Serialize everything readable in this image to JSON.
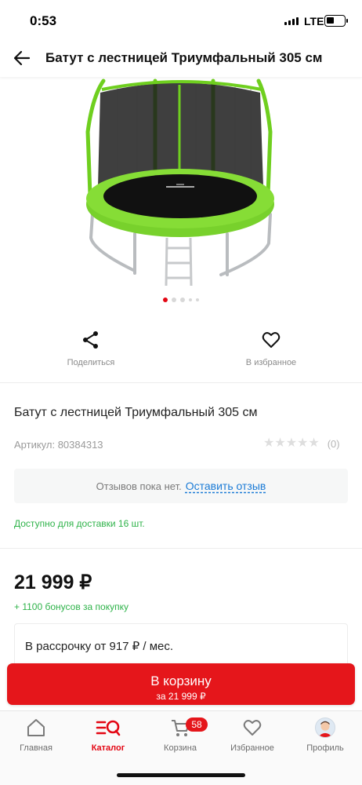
{
  "status_bar": {
    "time": "0:53",
    "network": "LTE"
  },
  "header": {
    "back_icon": "arrow-left-icon",
    "title": "Батут с лестницей Триумфальный 305 см"
  },
  "gallery": {
    "image": "trampoline-photo",
    "dots_count": 5,
    "active_index": 0
  },
  "actions": {
    "share_label": "Поделиться",
    "favorite_label": "В избранное"
  },
  "product": {
    "name": "Батут с лестницей Триумфальный 305 см",
    "sku": "Артикул: 80384313",
    "rating_stars": 0,
    "rating_count": "(0)"
  },
  "reviews": {
    "empty_text": "Отзывов пока нет.",
    "leave_review": "Оставить отзыв"
  },
  "availability": "Доступно для доставки 16 шт.",
  "pricing": {
    "price": "21 999 ₽",
    "bonus": "+ 1100 бонусов за покупку",
    "installment": "В рассрочку от 917 ₽ / мес."
  },
  "cart_button": {
    "label": "В корзину",
    "sublabel": "за 21 999 ₽"
  },
  "tab_bar": {
    "home": "Главная",
    "catalog": "Каталог",
    "cart": "Корзина",
    "cart_badge": "58",
    "favorites": "Избранное",
    "profile": "Профиль",
    "active": "catalog"
  },
  "colors": {
    "accent": "#e5161b",
    "green": "#2fb34a",
    "link": "#1b7bd6",
    "trampoline": "#78d12c"
  }
}
